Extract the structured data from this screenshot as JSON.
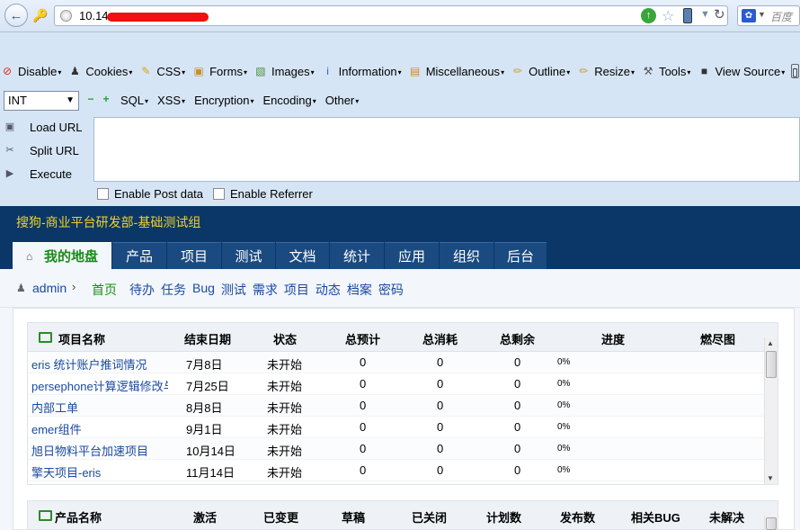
{
  "browser": {
    "url_prefix": "10.14.",
    "search_placeholder": "百度"
  },
  "hackbar": {
    "menu": [
      {
        "label": "Disable",
        "icon": "disable-icon",
        "color": "#d62a1e"
      },
      {
        "label": "Cookies",
        "icon": "cookies-icon",
        "color": "#333333"
      },
      {
        "label": "CSS",
        "icon": "css-icon",
        "color": "#e0a010"
      },
      {
        "label": "Forms",
        "icon": "forms-icon",
        "color": "#c7902a"
      },
      {
        "label": "Images",
        "icon": "images-icon",
        "color": "#4e8a3a"
      },
      {
        "label": "Information",
        "icon": "information-icon",
        "color": "#2a63c8"
      },
      {
        "label": "Miscellaneous",
        "icon": "miscellaneous-icon",
        "color": "#d88a20"
      },
      {
        "label": "Outline",
        "icon": "outline-icon",
        "color": "#c8a030"
      },
      {
        "label": "Resize",
        "icon": "resize-icon",
        "color": "#c8a030"
      },
      {
        "label": "Tools",
        "icon": "tools-icon",
        "color": "#555555"
      },
      {
        "label": "View Source",
        "icon": "view-source-icon",
        "color": "#333333"
      }
    ],
    "type_select": "INT",
    "row2_menu": [
      "SQL",
      "XSS",
      "Encryption",
      "Encoding",
      "Other"
    ],
    "actions": [
      "Load URL",
      "Split URL",
      "Execute"
    ],
    "checkboxes": [
      "Enable Post data",
      "Enable Referrer"
    ]
  },
  "app": {
    "title": "搜狗-商业平台研发部-基础测试组",
    "main_tabs": [
      "我的地盘",
      "产品",
      "项目",
      "测试",
      "文档",
      "统计",
      "应用",
      "组织",
      "后台"
    ],
    "user": "admin",
    "sub_nav": [
      "首页",
      "待办",
      "任务",
      "Bug",
      "测试",
      "需求",
      "项目",
      "动态",
      "档案",
      "密码"
    ]
  },
  "projects_table": {
    "headers": [
      "项目名称",
      "结束日期",
      "状态",
      "总预计",
      "总消耗",
      "总剩余",
      "进度",
      "燃尽图"
    ],
    "rows": [
      {
        "name": "eris 统计账户推词情况",
        "end": "7月8日",
        "status": "未开始",
        "est": "0",
        "consumed": "0",
        "left": "0",
        "progress": "0%"
      },
      {
        "name": "persephone计算逻辑修改与",
        "end": "7月25日",
        "status": "未开始",
        "est": "0",
        "consumed": "0",
        "left": "0",
        "progress": "0%"
      },
      {
        "name": "内部工单",
        "end": "8月8日",
        "status": "未开始",
        "est": "0",
        "consumed": "0",
        "left": "0",
        "progress": "0%"
      },
      {
        "name": "emer组件",
        "end": "9月1日",
        "status": "未开始",
        "est": "0",
        "consumed": "0",
        "left": "0",
        "progress": "0%"
      },
      {
        "name": "旭日物料平台加速项目",
        "end": "10月14日",
        "status": "未开始",
        "est": "0",
        "consumed": "0",
        "left": "0",
        "progress": "0%"
      },
      {
        "name": "擎天项目-eris",
        "end": "11月14日",
        "status": "未开始",
        "est": "0",
        "consumed": "0",
        "left": "0",
        "progress": "0%"
      }
    ]
  },
  "products_table": {
    "headers": [
      "产品名称",
      "激活",
      "已变更",
      "草稿",
      "已关闭",
      "计划数",
      "发布数",
      "相关BUG",
      "未解决"
    ]
  }
}
